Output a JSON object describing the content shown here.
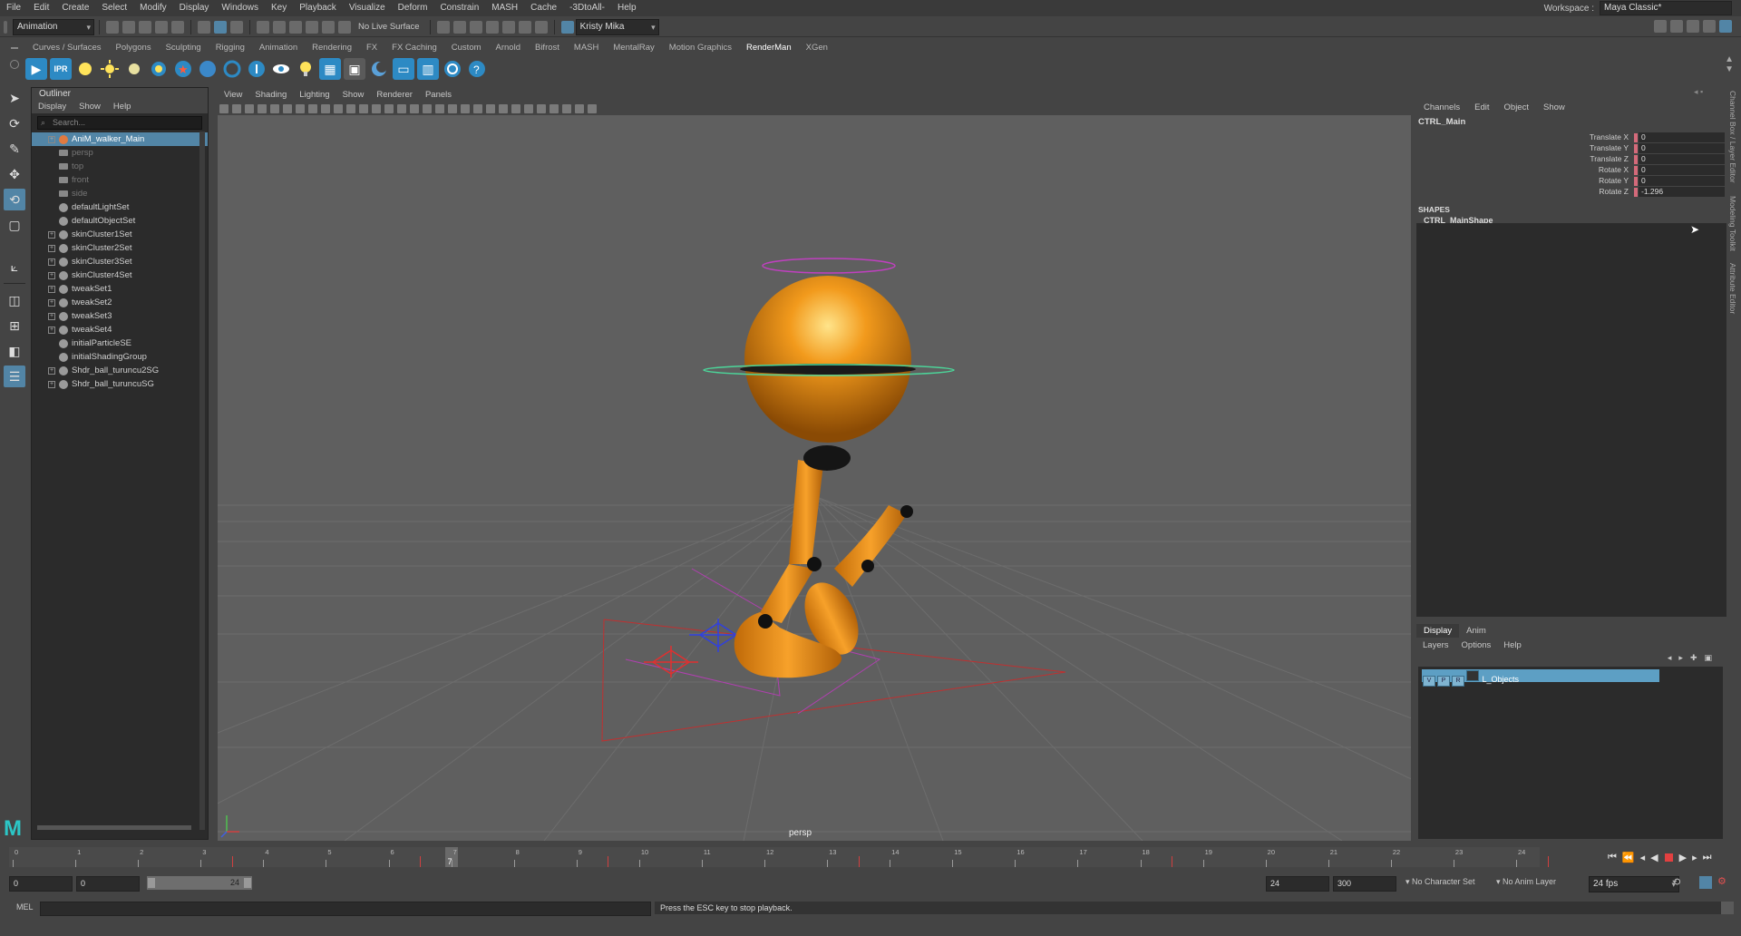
{
  "menubar": {
    "items": [
      "File",
      "Edit",
      "Create",
      "Select",
      "Modify",
      "Display",
      "Windows",
      "Key",
      "Playback",
      "Visualize",
      "Deform",
      "Constrain",
      "MASH",
      "Cache",
      "-3DtoAll-",
      "Help"
    ],
    "workspace_label": "Workspace :",
    "workspace_value": "Maya Classic*"
  },
  "statusline": {
    "mode": "Animation",
    "live_surface": "No Live Surface",
    "user": "Kristy Mika"
  },
  "shelf": {
    "tabs": [
      "Curves / Surfaces",
      "Polygons",
      "Sculpting",
      "Rigging",
      "Animation",
      "Rendering",
      "FX",
      "FX Caching",
      "Custom",
      "Arnold",
      "Bifrost",
      "MASH",
      "MentalRay",
      "Motion Graphics",
      "RenderMan",
      "XGen"
    ],
    "active_tab": "RenderMan",
    "ipr_label": "IPR"
  },
  "outliner": {
    "title": "Outliner",
    "menu": [
      "Display",
      "Show",
      "Help"
    ],
    "search_placeholder": "Search...",
    "items": [
      {
        "label": "AniM_walker_Main",
        "selected": true,
        "expandable": true,
        "icon": "transform-icon"
      },
      {
        "label": "persp",
        "dim": true,
        "icon": "camera-icon"
      },
      {
        "label": "top",
        "dim": true,
        "icon": "camera-icon"
      },
      {
        "label": "front",
        "dim": true,
        "icon": "camera-icon"
      },
      {
        "label": "side",
        "dim": true,
        "icon": "camera-icon"
      },
      {
        "label": "defaultLightSet",
        "icon": "set-icon"
      },
      {
        "label": "defaultObjectSet",
        "icon": "set-icon"
      },
      {
        "label": "skinCluster1Set",
        "expandable": true,
        "icon": "set-icon"
      },
      {
        "label": "skinCluster2Set",
        "expandable": true,
        "icon": "set-icon"
      },
      {
        "label": "skinCluster3Set",
        "expandable": true,
        "icon": "set-icon"
      },
      {
        "label": "skinCluster4Set",
        "expandable": true,
        "icon": "set-icon"
      },
      {
        "label": "tweakSet1",
        "expandable": true,
        "icon": "set-icon"
      },
      {
        "label": "tweakSet2",
        "expandable": true,
        "icon": "set-icon"
      },
      {
        "label": "tweakSet3",
        "expandable": true,
        "icon": "set-icon"
      },
      {
        "label": "tweakSet4",
        "expandable": true,
        "icon": "set-icon"
      },
      {
        "label": "initialParticleSE",
        "icon": "set-icon"
      },
      {
        "label": "initialShadingGroup",
        "icon": "set-icon"
      },
      {
        "label": "Shdr_ball_turuncu2SG",
        "expandable": true,
        "icon": "set-icon"
      },
      {
        "label": "Shdr_ball_turuncuSG",
        "expandable": true,
        "icon": "set-icon"
      }
    ]
  },
  "viewport": {
    "menu": [
      "View",
      "Shading",
      "Lighting",
      "Show",
      "Renderer",
      "Panels"
    ],
    "camera_label": "persp"
  },
  "channel_box": {
    "menu": [
      "Channels",
      "Edit",
      "Object",
      "Show"
    ],
    "object": "CTRL_Main",
    "channels": [
      {
        "label": "Translate X",
        "value": "0"
      },
      {
        "label": "Translate Y",
        "value": "0"
      },
      {
        "label": "Translate Z",
        "value": "0"
      },
      {
        "label": "Rotate X",
        "value": "0"
      },
      {
        "label": "Rotate Y",
        "value": "0"
      },
      {
        "label": "Rotate Z",
        "value": "-1.296"
      }
    ],
    "shapes_header": "SHAPES",
    "shape_name": "CTRL_MainShape"
  },
  "layer_editor": {
    "tabs": [
      "Display",
      "Anim"
    ],
    "active_tab": "Display",
    "menu": [
      "Layers",
      "Options",
      "Help"
    ],
    "layer": {
      "v": "V",
      "p": "P",
      "r": "R",
      "name": "L_Objects"
    }
  },
  "side_tabs": [
    "Channel Box / Layer Editor",
    "Modeling Toolkit",
    "Attribute Editor"
  ],
  "timeline": {
    "start": 0,
    "end": 24,
    "current": 7,
    "keys": [
      3,
      6,
      9,
      13,
      18,
      24
    ]
  },
  "range": {
    "start": "0",
    "anim_start": "0",
    "slider_start": "0",
    "slider_end": "24",
    "playback_end": "24",
    "anim_end": "300",
    "character_set": "No Character Set",
    "anim_layer": "No Anim Layer",
    "fps": "24 fps"
  },
  "command": {
    "lang": "MEL",
    "message": "Press the ESC key to stop playback."
  },
  "colors": {
    "accent": "#5285a6",
    "ball": "#e8890f",
    "panel": "#444444",
    "field": "#2b2b2b"
  }
}
